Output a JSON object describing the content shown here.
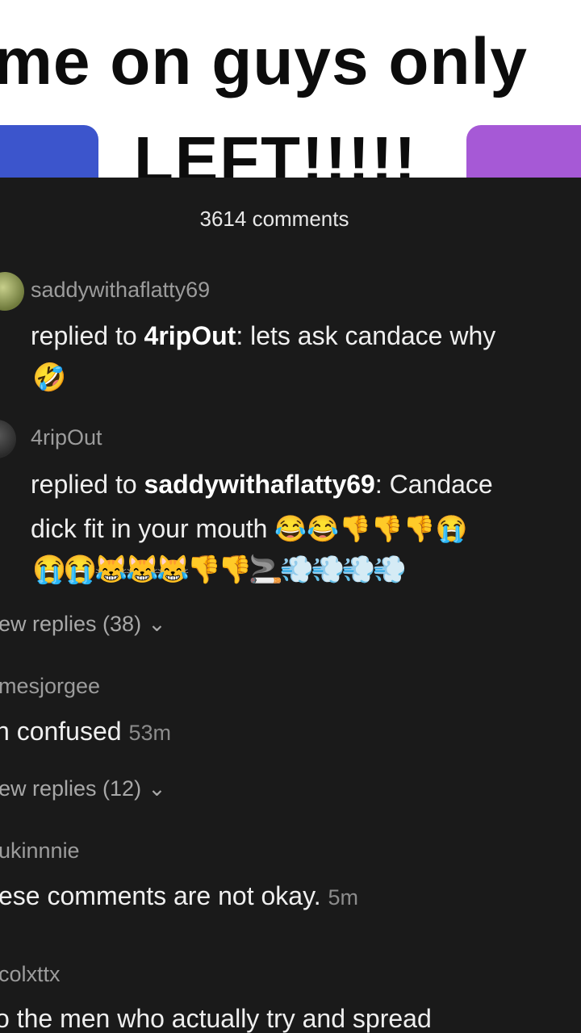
{
  "video": {
    "caption": "me on guys only",
    "subcaption": "LEFT!!!!!"
  },
  "comments_header": {
    "count_label": "3614 comments"
  },
  "comments": [
    {
      "username": "saddywithaflatty69",
      "reply_prefix": "replied to ",
      "reply_to": "4ripOut",
      "text": ": lets ask candace why",
      "emoji_line": "🤣"
    },
    {
      "username": "4ripOut",
      "reply_prefix": "replied to ",
      "reply_to": "saddywithaflatty69",
      "text": ": Candace",
      "text_line2": "dick fit in your mouth 😂😂👎👎👎😭",
      "emoji_line": "😭😭😹😹😹👎👎🚬💨💨💨💨"
    }
  ],
  "view_replies_1": {
    "label": "ew replies (38)",
    "chevron": "⌄"
  },
  "comment_3": {
    "username": "mesjorgee",
    "text": "n confused",
    "time": "53m"
  },
  "view_replies_2": {
    "label": "ew replies (12)",
    "chevron": "⌄"
  },
  "comment_4": {
    "username": "ukinnnie",
    "text": "ese comments are not okay.",
    "time": "5m"
  },
  "comment_5": {
    "username": "colxttx",
    "text": "o the men who actually try and spread"
  }
}
